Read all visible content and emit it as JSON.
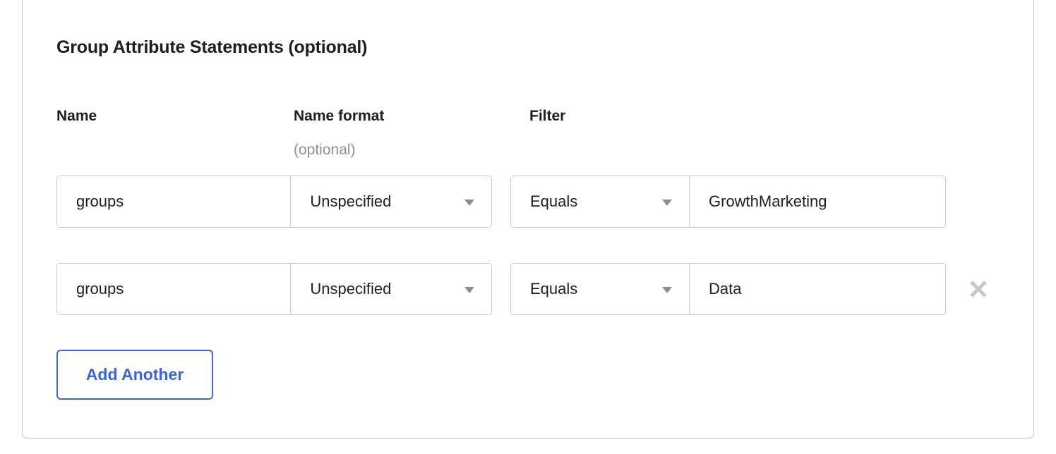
{
  "section": {
    "title": "Group Attribute Statements (optional)"
  },
  "columns": {
    "name": "Name",
    "name_format": "Name format",
    "name_format_sub": "(optional)",
    "filter": "Filter"
  },
  "rows": [
    {
      "name": "groups",
      "name_format": "Unspecified",
      "filter_type": "Equals",
      "filter_value": "GrowthMarketing",
      "removable": false
    },
    {
      "name": "groups",
      "name_format": "Unspecified",
      "filter_type": "Equals",
      "filter_value": "Data",
      "removable": true
    }
  ],
  "buttons": {
    "add_another": "Add Another"
  },
  "icons": {
    "caret": "chevron-down-icon",
    "remove": "close-x-icon"
  },
  "colors": {
    "accent_blue": "#3a64d8",
    "text": "#1d1f21",
    "muted_text": "#8c8f96",
    "border": "#c5c6cd",
    "background": "#ffffff"
  }
}
